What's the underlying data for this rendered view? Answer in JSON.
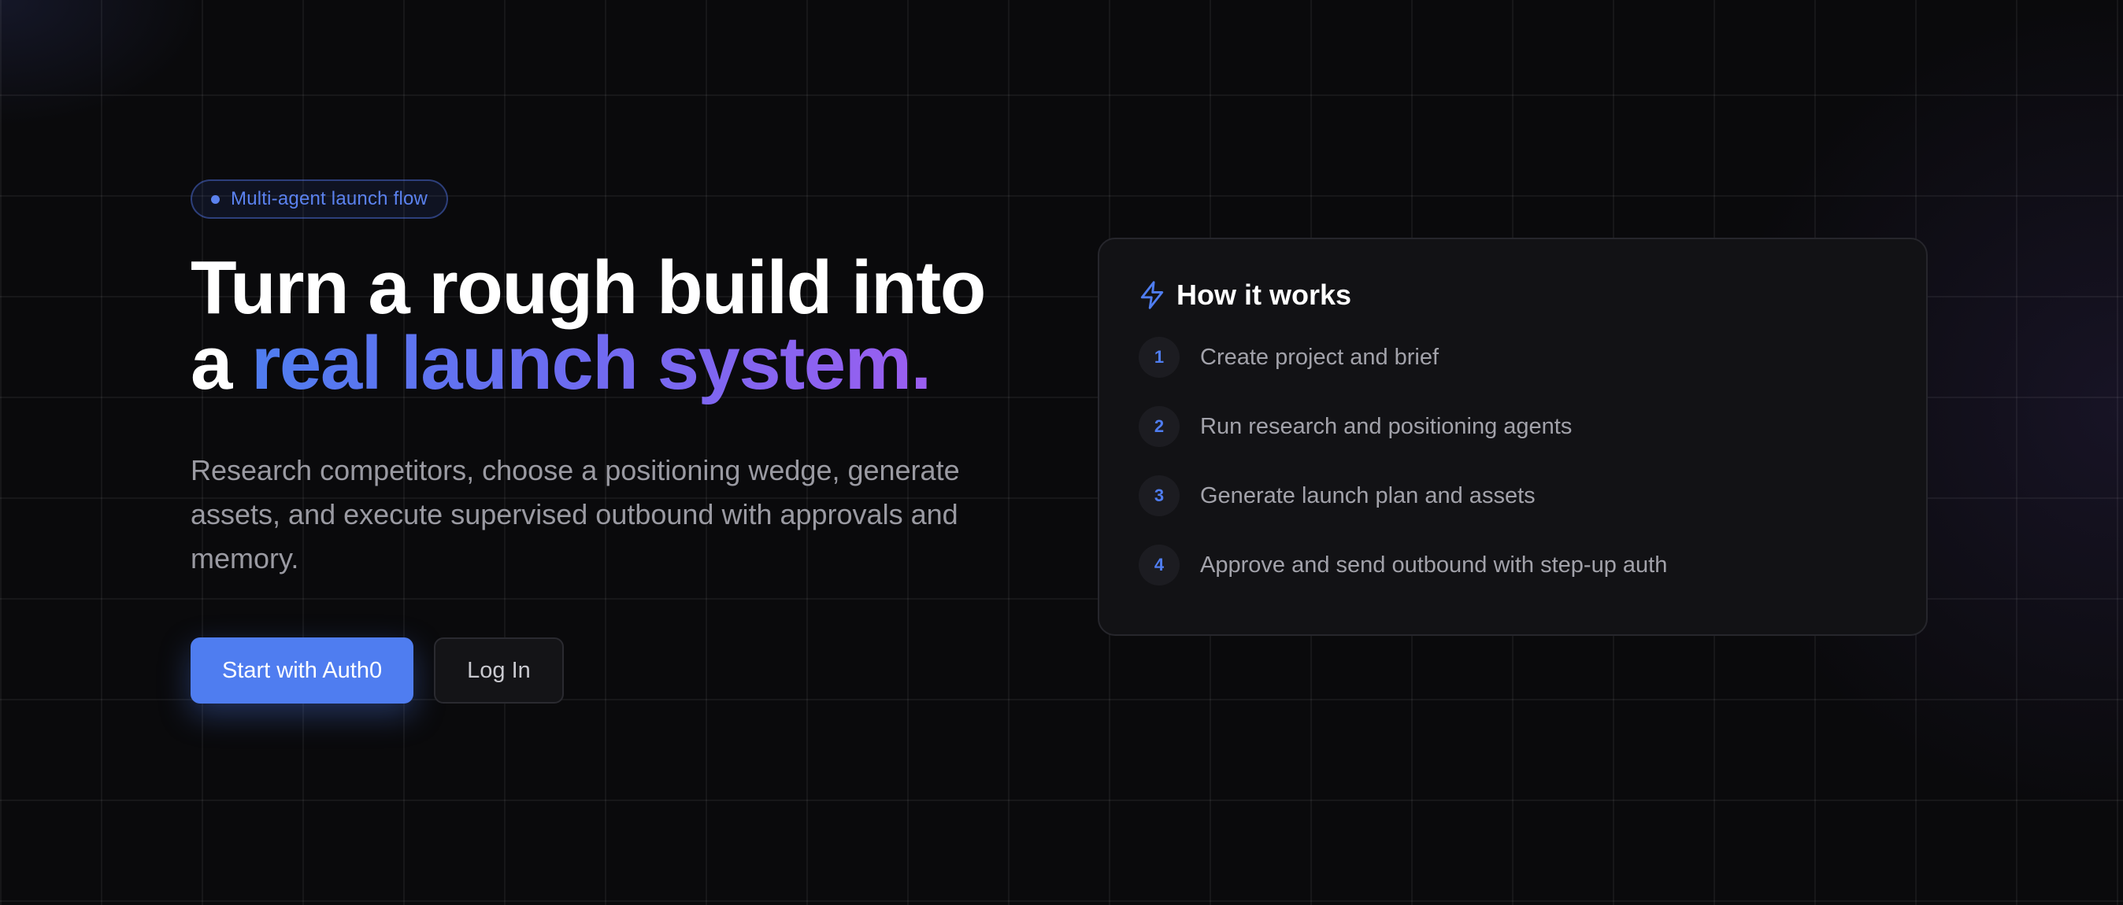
{
  "badge": {
    "label": "Multi-agent launch flow"
  },
  "hero": {
    "headline_line1": "Turn a rough build into",
    "headline_line2_prefix": "a ",
    "headline_line2_highlight": "real launch system.",
    "subtext": "Research competitors, choose a positioning wedge, generate assets, and execute supervised outbound with approvals and memory."
  },
  "actions": {
    "primary_label": "Start with Auth0",
    "secondary_label": "Log In"
  },
  "how_it_works": {
    "icon": "lightning-bolt-icon",
    "title": "How it works",
    "steps": [
      {
        "number": "1",
        "text": "Create project and brief"
      },
      {
        "number": "2",
        "text": "Run research and positioning agents"
      },
      {
        "number": "3",
        "text": "Generate launch plan and assets"
      },
      {
        "number": "4",
        "text": "Approve and send outbound with step-up auth"
      }
    ]
  },
  "colors": {
    "background": "#0a0a0c",
    "accent": "#4f7df0",
    "gradient_end": "#9b5ef0",
    "card": "#121215",
    "muted_text": "#9a9aa2"
  }
}
